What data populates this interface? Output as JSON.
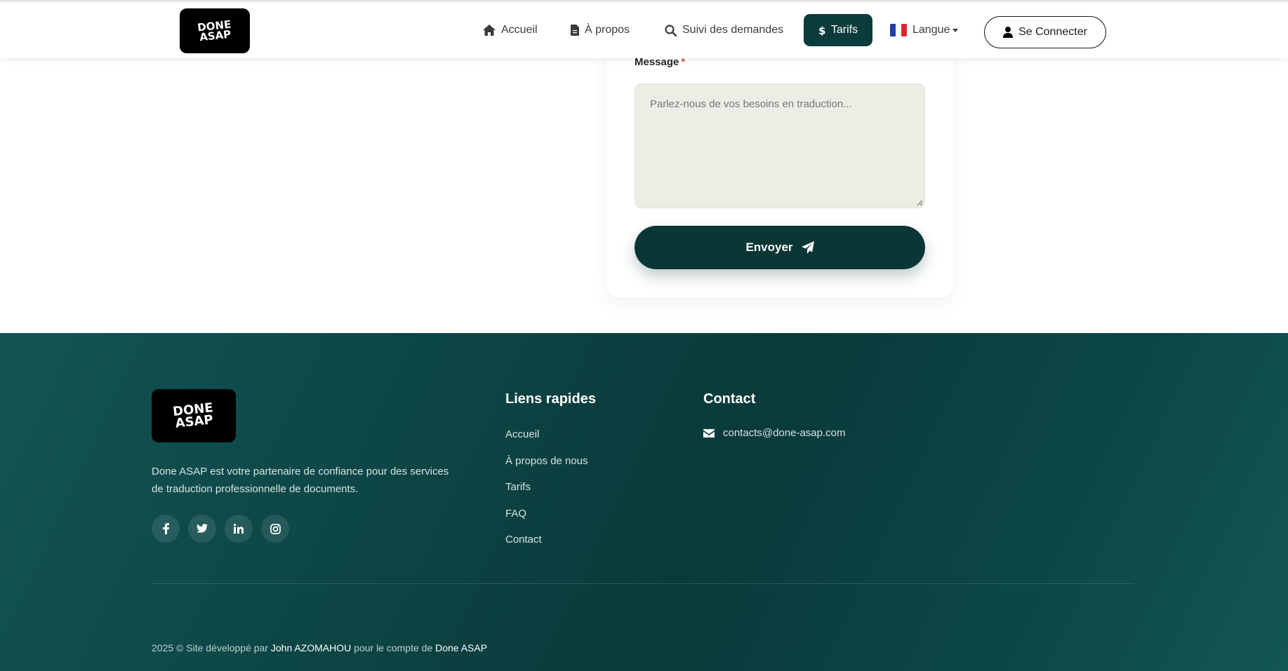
{
  "nav": {
    "logo_line1": "DONE",
    "logo_line2": "ASAP",
    "links": [
      {
        "label": "Accueil",
        "icon": "home-icon"
      },
      {
        "label": "À propos",
        "icon": "document-icon"
      },
      {
        "label": "Suivi des demandes",
        "icon": "search-icon"
      },
      {
        "label": "Tarifs",
        "icon": "dollar-icon",
        "active": true
      },
      {
        "label": "Langue",
        "icon": "france-flag-icon"
      }
    ],
    "login_label": "Se Connecter",
    "accent_color": "#0b3b3b"
  },
  "form": {
    "message_label": "Message",
    "required_mark": "*",
    "message_placeholder": "Parlez-nous de vos besoins en traduction...",
    "message_value": "",
    "submit_label": "Envoyer"
  },
  "footer": {
    "logo_line1": "DONE",
    "logo_line2": "ASAP",
    "description": "Done ASAP est votre partenaire de confiance pour des services de traduction professionnelle de documents.",
    "socials": [
      "facebook-icon",
      "twitter-icon",
      "linkedin-icon",
      "instagram-icon"
    ],
    "quick_links_title": "Liens rapides",
    "quick_links": [
      "Accueil",
      "À propos de nous",
      "Tarifs",
      "FAQ",
      "Contact"
    ],
    "contact_title": "Contact",
    "contact_email": "contacts@done-asap.com",
    "copyright_prefix": "2025 © Site développé par",
    "developer": "John AZOMAHOU",
    "copyright_middle": "pour le compte de",
    "company": "Done ASAP",
    "background_color": "#0b3e3e"
  }
}
